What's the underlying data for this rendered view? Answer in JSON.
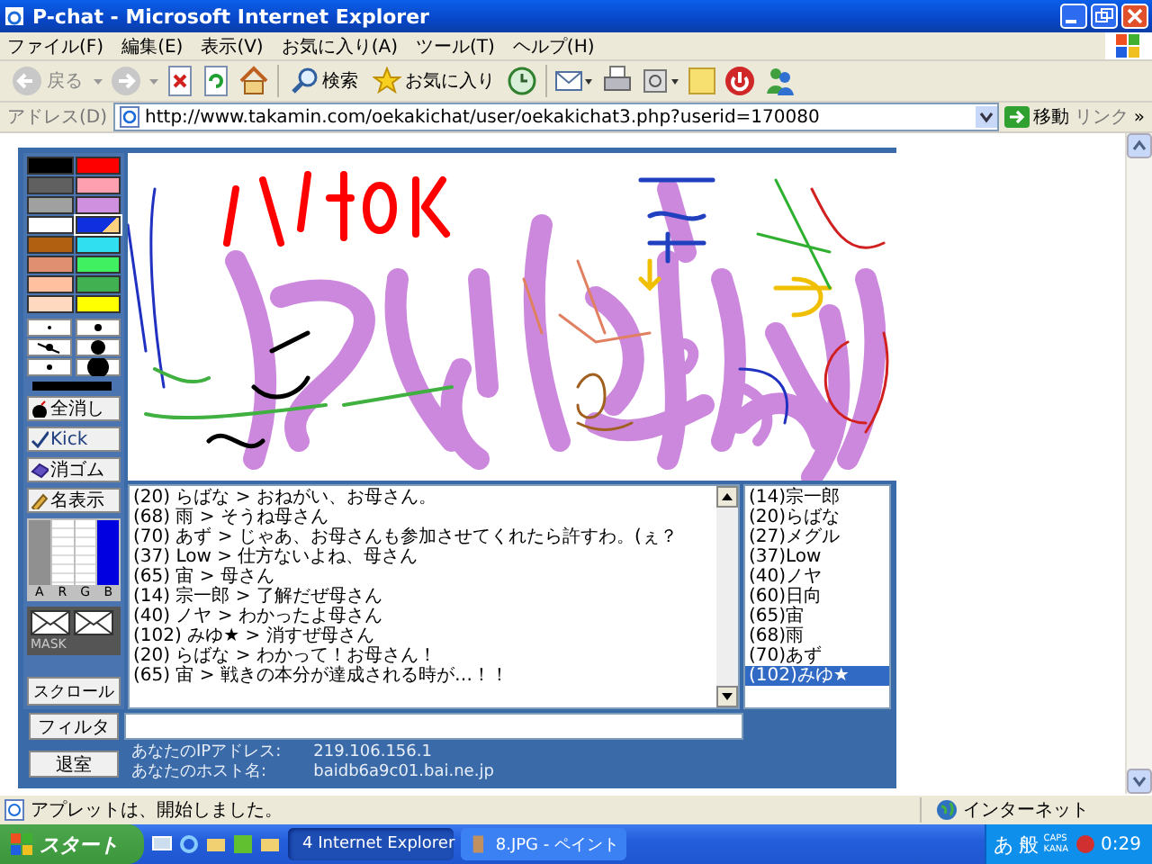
{
  "window": {
    "title": "P-chat - Microsoft Internet Explorer"
  },
  "menu": [
    "ファイル(F)",
    "編集(E)",
    "表示(V)",
    "お気に入り(A)",
    "ツール(T)",
    "ヘルプ(H)"
  ],
  "toolbar": {
    "back": "戻る",
    "search": "検索",
    "favorites": "お気に入り"
  },
  "address": {
    "label": "アドレス(D)",
    "url": "http://www.takamin.com/oekakichat/user/oekakichat3.php?userid=170080",
    "go": "移動",
    "links": "リンク",
    "more": "»"
  },
  "palette": {
    "colors": [
      {
        "color": "#000000",
        "selected": false
      },
      {
        "color": "#ff0000",
        "selected": false
      },
      {
        "color": "#606060",
        "selected": false
      },
      {
        "color": "#ffa0b0",
        "selected": false
      },
      {
        "color": "#a0a0a0",
        "selected": false
      },
      {
        "color": "#d090e0",
        "selected": false
      },
      {
        "color": "#ffffff",
        "selected": false
      },
      {
        "color": "#1030e0",
        "selected": true
      },
      {
        "color": "#b06010",
        "selected": false
      },
      {
        "color": "#30e0f0",
        "selected": false
      },
      {
        "color": "#e09070",
        "selected": false
      },
      {
        "color": "#40f060",
        "selected": false
      },
      {
        "color": "#ffc0a0",
        "selected": false
      },
      {
        "color": "#40b050",
        "selected": false
      },
      {
        "color": "#ffd8c0",
        "selected": false
      },
      {
        "color": "#ffff00",
        "selected": false
      }
    ],
    "tools": [
      {
        "kind": "clear",
        "label": "全消し"
      },
      {
        "kind": "kick",
        "label": "Kick"
      },
      {
        "kind": "eraser",
        "label": "消ゴム"
      },
      {
        "kind": "names",
        "label": "名表示"
      }
    ],
    "sliders": [
      {
        "label": "A",
        "level": 1
      },
      {
        "label": "R",
        "level": 0
      },
      {
        "label": "G",
        "level": 0
      },
      {
        "label": "B",
        "level": 1
      }
    ],
    "mask": "MASK",
    "scroll_button": "スクロール"
  },
  "chat": {
    "lines": [
      "(20) らばな > おねがい、お母さん。",
      "(68) 雨 > そうね母さん",
      "(70) あず > じゃあ、お母さんも参加させてくれたら許すわ。(ぇ？",
      "(37) Low > 仕方ないよね、母さん",
      "(65) 宙 > 母さん",
      "(14) 宗一郎 > 了解だぜ母さん",
      "(40) ノヤ > わかったよ母さん",
      "(102) みゆ★ > 消すぜ母さん",
      "(20) らばな > わかって！お母さん！",
      "(65) 宙 > 戦きの本分が達成される時が…！！"
    ]
  },
  "users": [
    {
      "name": "(14)宗一郎",
      "selected": false
    },
    {
      "name": "(20)らばな",
      "selected": false
    },
    {
      "name": "(27)メグル",
      "selected": false
    },
    {
      "name": "(37)Low",
      "selected": false
    },
    {
      "name": "(40)ノヤ",
      "selected": false
    },
    {
      "name": "(60)日向",
      "selected": false
    },
    {
      "name": "(65)宙",
      "selected": false
    },
    {
      "name": "(68)雨",
      "selected": false
    },
    {
      "name": "(70)あず",
      "selected": false
    },
    {
      "name": "(102)みゆ★",
      "selected": true
    }
  ],
  "filter_button": "フィルタ",
  "leave_button": "退室",
  "info": [
    {
      "label": "あなたのIPアドレス:",
      "value": "219.106.156.1"
    },
    {
      "label": "あなたのホスト名:",
      "value": "baidb6a9c01.bai.ne.jp"
    }
  ],
  "status": {
    "text": "アプレットは、開始しました。",
    "zone": "インターネット"
  },
  "taskbar": {
    "start": "スタート",
    "tasks": [
      {
        "label": "4 Internet Explorer",
        "selected": true
      },
      {
        "label": "8.JPG - ペイント",
        "selected": false
      }
    ],
    "ime": [
      "あ",
      "般"
    ],
    "caps": "CAPS",
    "kana": "KANA",
    "clock": "0:29"
  }
}
